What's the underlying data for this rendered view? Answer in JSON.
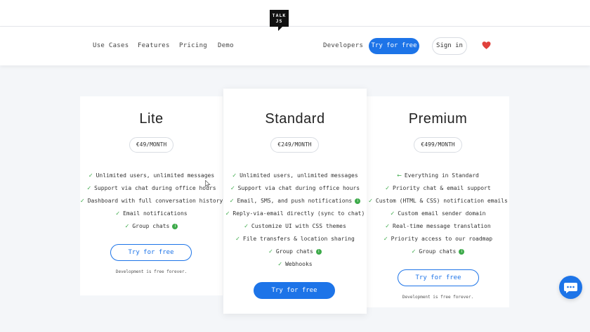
{
  "nav": {
    "links": [
      "Use Cases",
      "Features",
      "Pricing",
      "Demo"
    ],
    "logo_line1": "TALK",
    "logo_line2": "JS",
    "developers": "Developers",
    "try_free": "Try for free",
    "sign_in": "Sign in",
    "heart_icon": "heart-icon",
    "heart_color": "#e0413c"
  },
  "plans": {
    "lite": {
      "title": "Lite",
      "price": "€49/MONTH",
      "features": [
        {
          "text": "Unlimited users, unlimited messages",
          "icon": "check"
        },
        {
          "text": "Support via chat during office hours",
          "icon": "check"
        },
        {
          "text": "Dashboard with full conversation history",
          "icon": "check"
        },
        {
          "text": "Email notifications",
          "icon": "check"
        },
        {
          "text": "Group chats",
          "icon": "check",
          "info": true
        }
      ],
      "button": "Try for free",
      "note": "Development is free forever."
    },
    "standard": {
      "title": "Standard",
      "price": "€249/MONTH",
      "features": [
        {
          "text": "Unlimited users, unlimited messages",
          "icon": "check"
        },
        {
          "text": "Support via chat during office hours",
          "icon": "check"
        },
        {
          "text": "Email, SMS, and push notifications",
          "icon": "check",
          "info": true
        },
        {
          "text": "Reply-via-email directly (sync to chat)",
          "icon": "check"
        },
        {
          "text": "Customize UI with CSS themes",
          "icon": "check"
        },
        {
          "text": "File transfers & location sharing",
          "icon": "check"
        },
        {
          "text": "Group chats",
          "icon": "check",
          "info": true
        },
        {
          "text": "Webhooks",
          "icon": "check"
        }
      ],
      "button": "Try for free"
    },
    "premium": {
      "title": "Premium",
      "price": "€499/MONTH",
      "features": [
        {
          "text": "Everything in Standard",
          "icon": "arrow"
        },
        {
          "text": "Priority chat & email support",
          "icon": "check"
        },
        {
          "text": "Custom (HTML & CSS) notification emails",
          "icon": "check"
        },
        {
          "text": "Custom email sender domain",
          "icon": "check"
        },
        {
          "text": "Real-time message translation",
          "icon": "check"
        },
        {
          "text": "Priority access to our roadmap",
          "icon": "check"
        },
        {
          "text": "Group chats",
          "icon": "check",
          "info": true
        }
      ],
      "button": "Try for free",
      "note": "Development is free forever."
    }
  },
  "colors": {
    "accent": "#1d74e8",
    "check": "#3daa4a",
    "background": "#f4f6f9"
  },
  "chat_widget_icon": "chat-bubble-icon"
}
